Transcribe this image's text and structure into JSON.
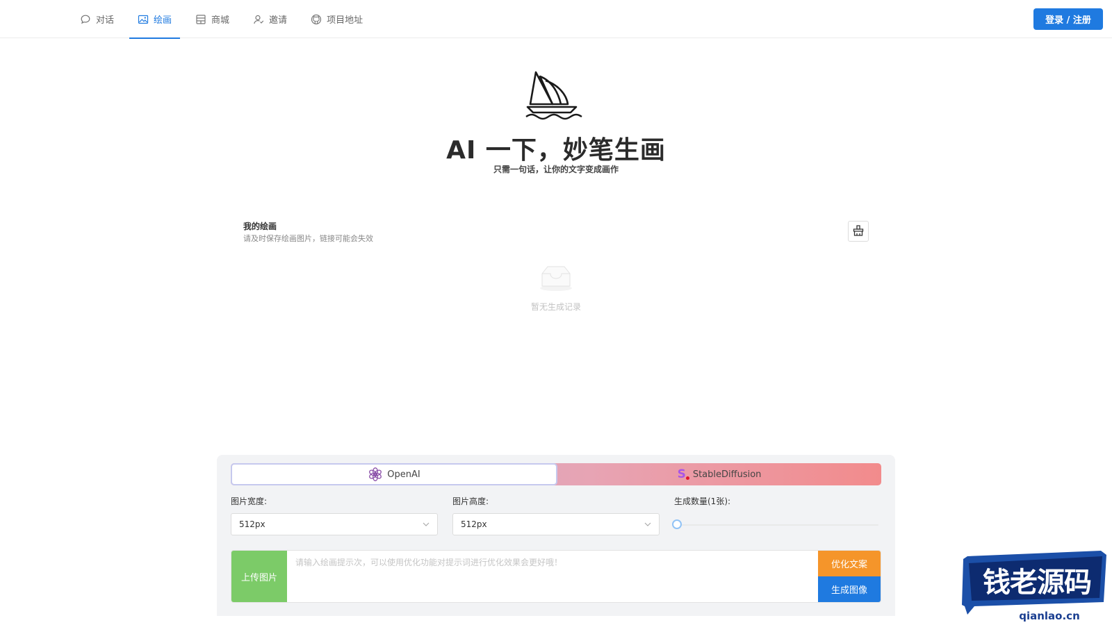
{
  "nav": {
    "items": [
      {
        "label": "对话",
        "icon": "chat-icon"
      },
      {
        "label": "绘画",
        "icon": "image-icon",
        "active": true
      },
      {
        "label": "商城",
        "icon": "shop-icon"
      },
      {
        "label": "邀请",
        "icon": "invite-icon"
      },
      {
        "label": "项目地址",
        "icon": "github-icon"
      }
    ],
    "login_label": "登录 / 注册"
  },
  "hero": {
    "logo": "sailboat-logo",
    "title": "AI 一下，妙笔生画",
    "subtitle": "只需一句话，让你的文字变成画作"
  },
  "gallery": {
    "title": "我的绘画",
    "tip": "请及时保存绘画图片，链接可能会失效",
    "clear_icon": "broom-icon",
    "empty_text": "暂无生成记录"
  },
  "panel": {
    "tabs": [
      {
        "label": "OpenAI",
        "icon": "openai-icon",
        "active": true
      },
      {
        "label": "StableDiffusion",
        "icon": "stable-diffusion-icon"
      }
    ],
    "width_label": "图片宽度:",
    "width_value": "512px",
    "height_label": "图片高度:",
    "height_value": "512px",
    "count_label": "生成数量(1张):",
    "count_value": 1,
    "upload_label": "上传图片",
    "prompt_placeholder": "请输入绘画提示次，可以使用优化功能对提示词进行优化效果会更好哦！",
    "optimize_label": "优化文案",
    "generate_label": "生成图像"
  },
  "watermark": {
    "text": "钱老源码",
    "domain": "qianlao.cn"
  },
  "colors": {
    "primary": "#1f7ae0",
    "orange": "#f5952a",
    "green": "#7ccb68"
  }
}
